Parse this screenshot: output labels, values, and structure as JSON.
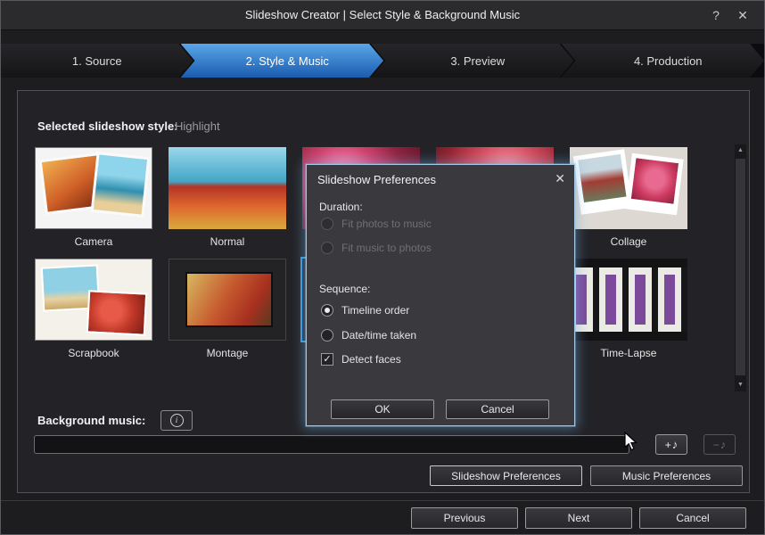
{
  "colors": {
    "accent_blue": "#2e7fd2",
    "selection_blue": "#2f9be8",
    "window_bg": "#1d1d20"
  },
  "icons": {
    "help": "?",
    "close": "✕",
    "info": "i",
    "note": "♪",
    "up_arrow": "▲",
    "down_arrow": "▼",
    "check": "✓"
  },
  "titlebar": {
    "title": "Slideshow Creator | Select Style & Background Music"
  },
  "wizard": {
    "tabs": [
      {
        "label": "1. Source",
        "active": false
      },
      {
        "label": "2. Style & Music",
        "active": true
      },
      {
        "label": "3. Preview",
        "active": false
      },
      {
        "label": "4. Production",
        "active": false
      }
    ]
  },
  "styles": {
    "header_label": "Selected slideshow style:",
    "selected_name": "Highlight",
    "items": [
      {
        "name": "Camera"
      },
      {
        "name": "Normal"
      },
      {
        "name": ""
      },
      {
        "name": ""
      },
      {
        "name": "Collage"
      },
      {
        "name": "Scrapbook"
      },
      {
        "name": "Montage"
      },
      {
        "name": ""
      },
      {
        "name": ""
      },
      {
        "name": "Time-Lapse"
      }
    ]
  },
  "dialog": {
    "title": "Slideshow Preferences",
    "duration_label": "Duration:",
    "duration_options": [
      {
        "label": "Fit photos to music",
        "enabled": false,
        "selected": false
      },
      {
        "label": "Fit music to photos",
        "enabled": false,
        "selected": false
      }
    ],
    "sequence_label": "Sequence:",
    "sequence_options": [
      {
        "label": "Timeline order",
        "selected": true
      },
      {
        "label": "Date/time taken",
        "selected": false
      }
    ],
    "detect_faces": {
      "label": "Detect faces",
      "checked": true
    },
    "ok_label": "OK",
    "cancel_label": "Cancel"
  },
  "music": {
    "label": "Background music:",
    "input_value": "",
    "add_label": "+",
    "remove_label": "−",
    "slideshow_preferences_label": "Slideshow Preferences",
    "music_preferences_label": "Music Preferences"
  },
  "footer": {
    "previous_label": "Previous",
    "next_label": "Next",
    "cancel_label": "Cancel"
  }
}
